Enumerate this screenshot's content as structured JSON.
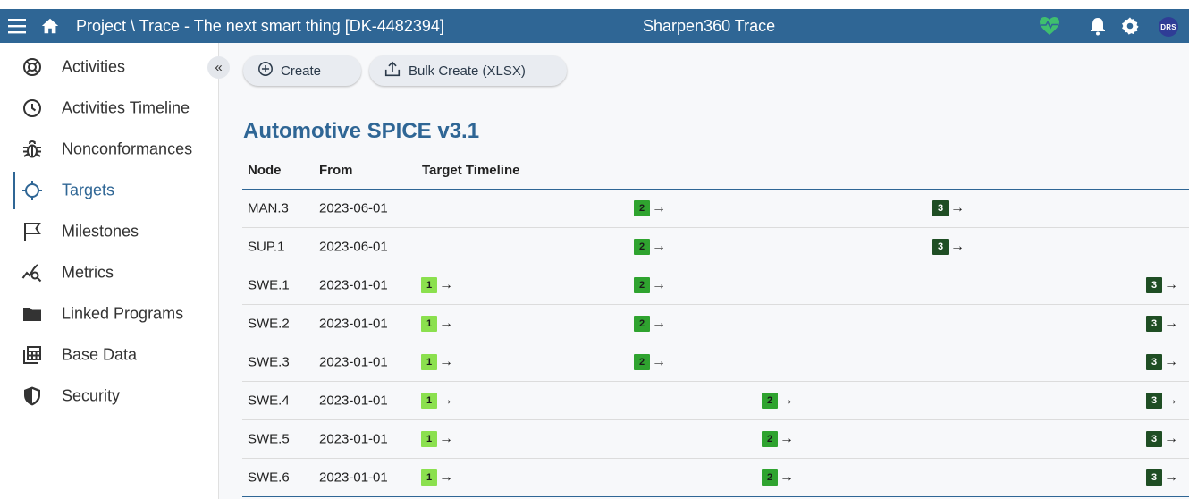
{
  "header": {
    "breadcrumb": "Project \\ Trace - The next smart thing [DK-4482394]",
    "app_name": "Sharpen360 Trace",
    "avatar_initials": "DRS",
    "bar_color": "#2f6695",
    "health_color": "#3fbf6f",
    "icons": [
      "menu-icon",
      "home-icon",
      "heart-pulse-icon",
      "bell-icon",
      "gear-icon"
    ]
  },
  "sidebar": {
    "collapse_glyph": "«",
    "items": [
      {
        "label": "Activities",
        "icon": "lifebuoy-icon"
      },
      {
        "label": "Activities Timeline",
        "icon": "clock-icon"
      },
      {
        "label": "Nonconformances",
        "icon": "bug-icon"
      },
      {
        "label": "Targets",
        "icon": "target-icon",
        "active": true
      },
      {
        "label": "Milestones",
        "icon": "flag-icon"
      },
      {
        "label": "Metrics",
        "icon": "trend-search-icon"
      },
      {
        "label": "Linked Programs",
        "icon": "folder-icon"
      },
      {
        "label": "Base Data",
        "icon": "table-stack-icon"
      },
      {
        "label": "Security",
        "icon": "shield-icon"
      }
    ]
  },
  "toolbar": {
    "create_label": "Create",
    "bulk_label": "Bulk Create (XLSX)"
  },
  "main": {
    "title": "Automotive SPICE v3.1",
    "columns": [
      "Node",
      "From",
      "Target Timeline"
    ],
    "level_colors": {
      "1": "#8be04e",
      "2": "#2fa32f",
      "3": "#1f4e24"
    },
    "rows": [
      {
        "node": "MAN.3",
        "from": "2023-06-01",
        "targets": [
          {
            "level": "2",
            "slot": 2
          },
          {
            "level": "3",
            "slot": 3
          }
        ]
      },
      {
        "node": "SUP.1",
        "from": "2023-06-01",
        "targets": [
          {
            "level": "2",
            "slot": 2
          },
          {
            "level": "3",
            "slot": 3
          }
        ]
      },
      {
        "node": "SWE.1",
        "from": "2023-01-01",
        "targets": [
          {
            "level": "1",
            "slot": 1
          },
          {
            "level": "2",
            "slot": 2
          },
          {
            "level": "3",
            "slot": 5
          }
        ]
      },
      {
        "node": "SWE.2",
        "from": "2023-01-01",
        "targets": [
          {
            "level": "1",
            "slot": 1
          },
          {
            "level": "2",
            "slot": 2
          },
          {
            "level": "3",
            "slot": 5
          }
        ]
      },
      {
        "node": "SWE.3",
        "from": "2023-01-01",
        "targets": [
          {
            "level": "1",
            "slot": 1
          },
          {
            "level": "2",
            "slot": 2
          },
          {
            "level": "3",
            "slot": 5
          }
        ]
      },
      {
        "node": "SWE.4",
        "from": "2023-01-01",
        "targets": [
          {
            "level": "1",
            "slot": 1
          },
          {
            "level": "2",
            "slot": 4
          },
          {
            "level": "3",
            "slot": 5
          }
        ]
      },
      {
        "node": "SWE.5",
        "from": "2023-01-01",
        "targets": [
          {
            "level": "1",
            "slot": 1
          },
          {
            "level": "2",
            "slot": 4
          },
          {
            "level": "3",
            "slot": 5
          }
        ]
      },
      {
        "node": "SWE.6",
        "from": "2023-01-01",
        "targets": [
          {
            "level": "1",
            "slot": 1
          },
          {
            "level": "2",
            "slot": 4
          },
          {
            "level": "3",
            "slot": 5
          }
        ]
      }
    ]
  }
}
